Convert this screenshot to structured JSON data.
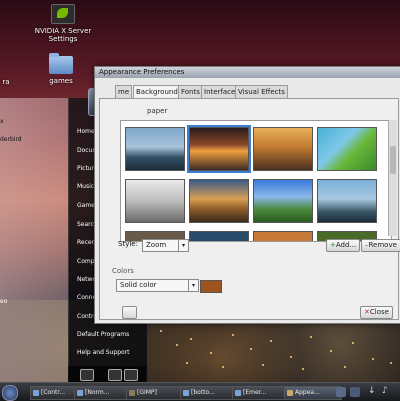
{
  "desktop": {
    "icons": [
      {
        "label_line1": "NVIDIA X Server",
        "label_line2": "Settings"
      },
      {
        "label": "games"
      },
      {
        "label": "ra"
      }
    ]
  },
  "start_menu": {
    "left_items": [
      "x",
      "derbird",
      "eo"
    ],
    "right_items": [
      "Home Folder",
      "Documents",
      "Pictures",
      "Music",
      "Games",
      "Search",
      "Recent Items",
      "Computer",
      "Network",
      "Connect To",
      "Control Panel",
      "Default Programs",
      "Help and Support"
    ]
  },
  "appearance": {
    "title": "Appearance Preferences",
    "tabs": [
      "me",
      "Background",
      "Fonts",
      "Interface",
      "Visual Effects"
    ],
    "wallpaper_label": "paper",
    "style_label": "Style:",
    "style_value": "Zoom",
    "add_label": "Add...",
    "remove_label": "Remove",
    "colors_label": "Colors",
    "color_mode_value": "Solid color",
    "close_label": "Close",
    "color_swatch": "#a0521e",
    "selected_wallpaper_index": 1
  },
  "taskbar": {
    "tasks": [
      "[Contr...",
      "[Norm...",
      "[GIMP]",
      "[botto...",
      "[Emer...",
      "Appea..."
    ]
  }
}
